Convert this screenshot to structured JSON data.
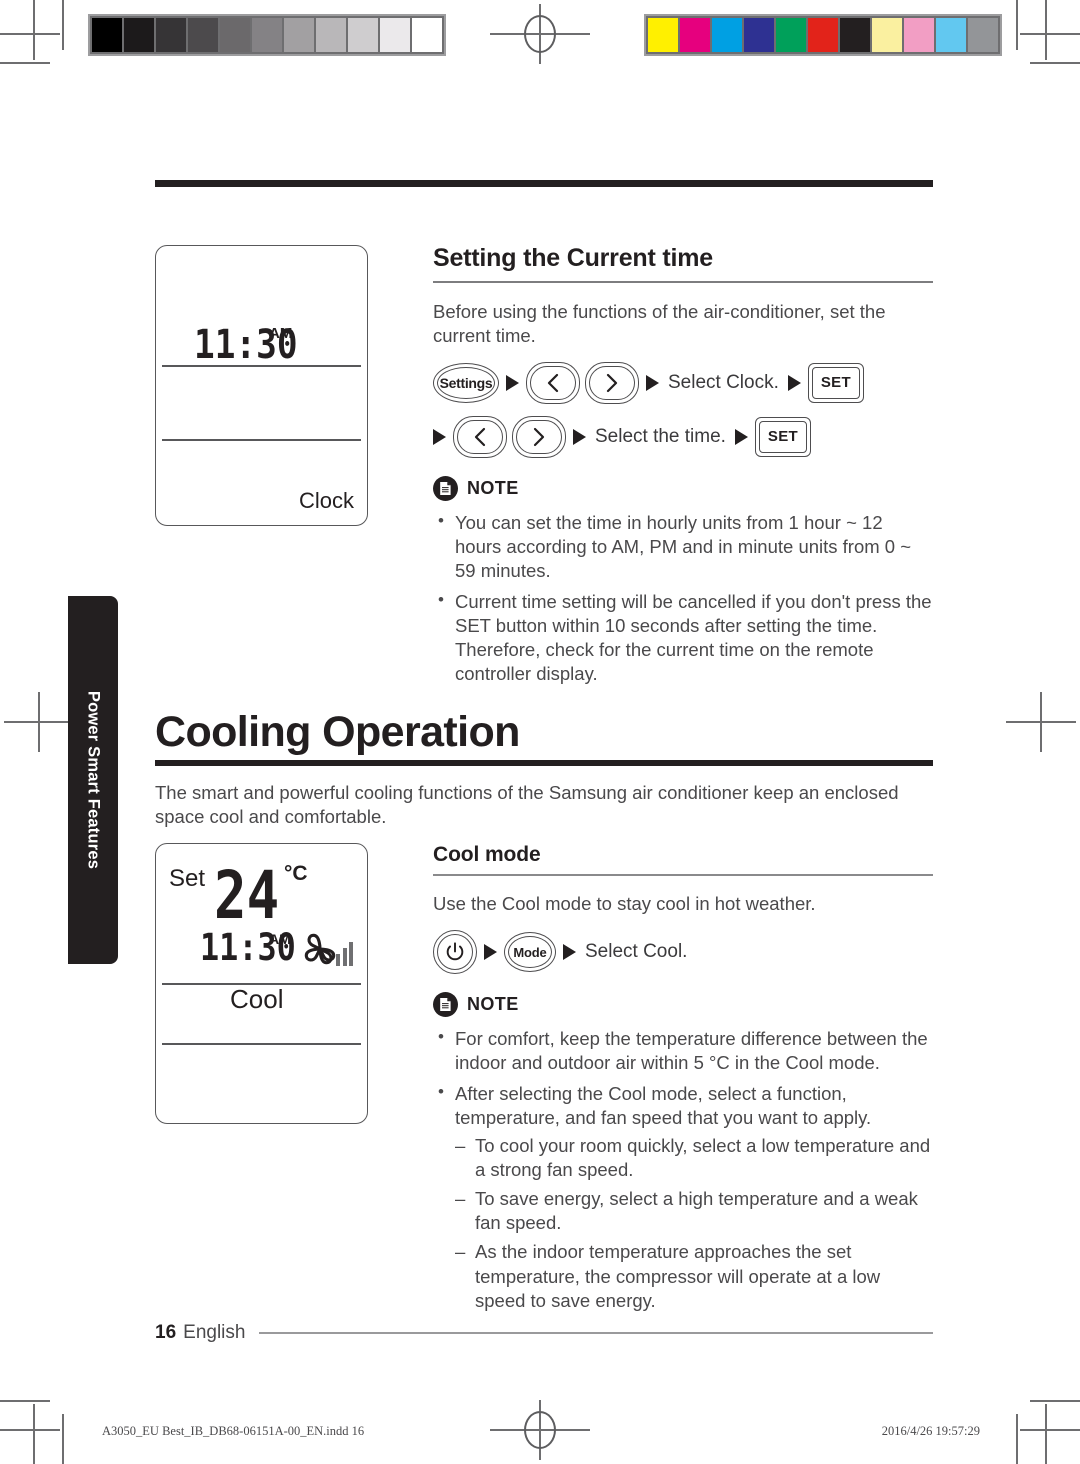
{
  "print_marks": {
    "grayscale_swatches": [
      "#000000",
      "#1c1a1b",
      "#363436",
      "#4c4a4c",
      "#6b696b",
      "#848285",
      "#a2a0a2",
      "#b9b7b9",
      "#cfcdcf",
      "#ebe9eb",
      "#ffffff"
    ],
    "color_swatches": [
      "#fff000",
      "#e6007e",
      "#00a0e3",
      "#2e3192",
      "#00a05a",
      "#e2231a",
      "#231f20",
      "#faf0a0",
      "#f29ec4",
      "#62c8f0",
      "#939598"
    ]
  },
  "thumb_tab": {
    "label": "Power Smart Features"
  },
  "clock_display": {
    "time": "11:30",
    "meridiem": "AM",
    "mode_label": "Clock"
  },
  "cool_display": {
    "set_label": "Set",
    "temperature": "24",
    "unit": "°C",
    "time": "11:30",
    "meridiem": "AM",
    "mode_label": "Cool",
    "fan_icon": "fan-icon",
    "fan_speed_bars": 3
  },
  "section_clock": {
    "heading": "Setting the Current time",
    "intro": "Before using the functions of the air-conditioner, set the current time.",
    "steps_row1": {
      "settings_button": "Settings",
      "left_button": "chevron-left-icon",
      "right_button": "chevron-right-icon",
      "instruction": "Select Clock.",
      "set_button": "SET"
    },
    "steps_row2": {
      "left_button": "chevron-left-icon",
      "right_button": "chevron-right-icon",
      "instruction": "Select the time.",
      "set_button": "SET"
    },
    "note": {
      "title": "NOTE",
      "icon": "note-document-icon",
      "bullets": [
        "You can set the time in hourly units from 1 hour ~ 12 hours according to AM, PM and in minute units from 0 ~ 59 minutes.",
        "Current time setting will be cancelled if you don't press the SET button within 10 seconds after setting the time. Therefore, check for the current time on the remote controller display."
      ]
    }
  },
  "section_cooling": {
    "heading": "Cooling Operation",
    "intro": "The smart and powerful cooling functions of the Samsung air conditioner keep an enclosed space cool and comfortable.",
    "subsection": {
      "heading": "Cool mode",
      "intro": "Use the Cool mode to stay cool in hot weather.",
      "steps": {
        "power_button": "power-icon",
        "mode_button": "Mode",
        "instruction": "Select Cool."
      },
      "note": {
        "title": "NOTE",
        "icon": "note-document-icon",
        "bullets": [
          {
            "text": "For comfort, keep the temperature difference between the indoor and outdoor air within 5 °C in the Cool mode.",
            "sub": []
          },
          {
            "text": "After selecting the Cool mode, select a function, temperature, and fan speed that you want to apply.",
            "sub": [
              "To cool your room quickly, select a low temperature and a strong fan speed.",
              "To save energy, select a high temperature and a weak fan speed.",
              "As the indoor temperature approaches the set temperature, the compressor will operate at a low speed to save energy."
            ]
          }
        ]
      }
    }
  },
  "footer": {
    "page_number": "16",
    "language": "English",
    "imprint_left": "A3050_EU Best_IB_DB68-06151A-00_EN.indd  16",
    "imprint_right": "2016/4/26  19:57:29"
  }
}
